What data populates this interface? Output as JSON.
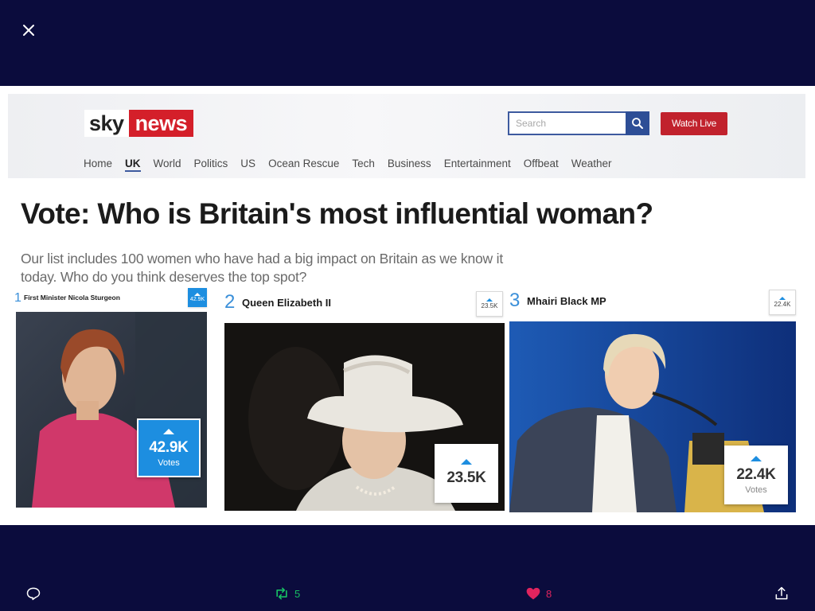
{
  "viewer": {
    "close_icon": "close-icon"
  },
  "site": {
    "logo_sky": "sky",
    "logo_news": "news",
    "search_placeholder": "Search",
    "watch_live": "Watch Live",
    "nav": [
      "Home",
      "UK",
      "World",
      "Politics",
      "US",
      "Ocean Rescue",
      "Tech",
      "Business",
      "Entertainment",
      "Offbeat",
      "Weather"
    ],
    "active_nav": "UK",
    "brand_color": "#d41f2a",
    "accent_color": "#1d8ee0"
  },
  "article": {
    "headline": "Vote: Who is Britain's most influential woman?",
    "intro": "Our list includes 100 women who have had a big impact on Britain as we know it today. Who do you think deserves the top spot?",
    "candidates": [
      {
        "rank": "1",
        "name": "First Minister Nicola Sturgeon",
        "mini_count": "42.9K",
        "votes": "42.9K",
        "votes_label": "Votes"
      },
      {
        "rank": "2",
        "name": "Queen Elizabeth II",
        "mini_count": "23.5K",
        "votes": "23.5K",
        "votes_label": ""
      },
      {
        "rank": "3",
        "name": "Mhairi Black MP",
        "mini_count": "22.4K",
        "votes": "22.4K",
        "votes_label": "Votes"
      }
    ]
  },
  "tweet_actions": {
    "reply_icon": "reply-icon",
    "retweet_count": "5",
    "like_count": "8",
    "retweet_color": "#17bf63",
    "like_color": "#e0245e",
    "share_icon": "share-icon"
  }
}
